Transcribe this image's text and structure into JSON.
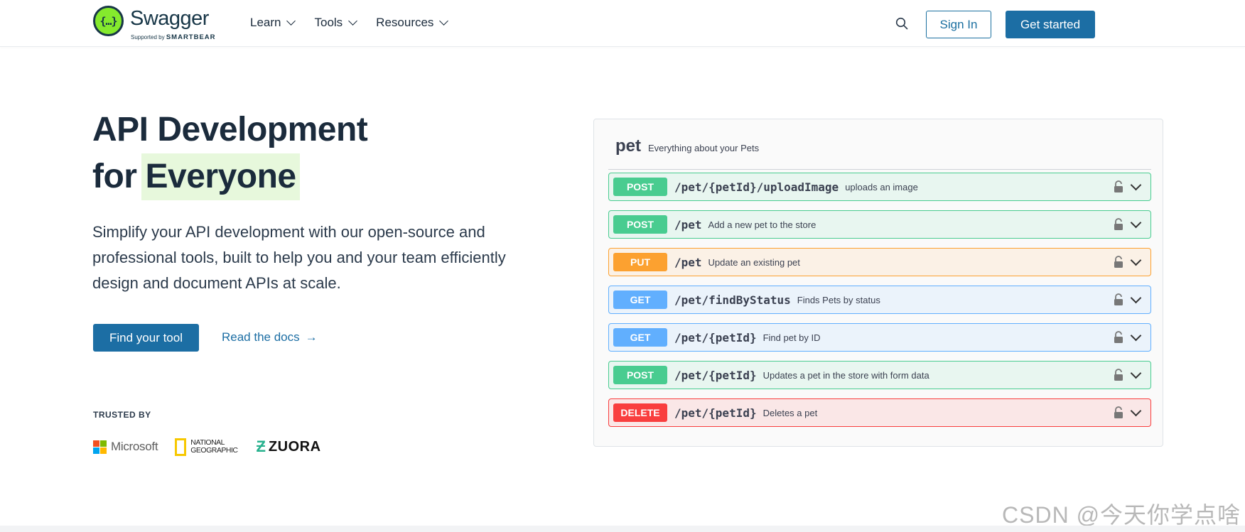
{
  "header": {
    "logo": {
      "word": "Swagger",
      "supported_by": "Supported by",
      "brand": "SMARTBEAR"
    },
    "nav": [
      {
        "label": "Learn"
      },
      {
        "label": "Tools"
      },
      {
        "label": "Resources"
      }
    ],
    "signin_label": "Sign In",
    "getstarted_label": "Get started"
  },
  "hero": {
    "title_line1": "API Development",
    "title_line2_a": "for",
    "title_line2_b": "Everyone",
    "description": "Simplify your API development with our open-source and professional tools, built to help you and your team efficiently design and document APIs at scale.",
    "primary_cta": "Find your tool",
    "secondary_cta": "Read the docs",
    "secondary_arrow": "→"
  },
  "trusted": {
    "label": "TRUSTED BY",
    "logos": [
      {
        "name": "Microsoft"
      },
      {
        "name_line1": "NATIONAL",
        "name_line2": "GEOGRAPHIC"
      },
      {
        "name": "ZUORA"
      }
    ]
  },
  "panel": {
    "tag": "pet",
    "tag_description": "Everything about your Pets",
    "operations": [
      {
        "method": "POST",
        "path": "/pet/{petId}/uploadImage",
        "summary": "uploads an image"
      },
      {
        "method": "POST",
        "path": "/pet",
        "summary": "Add a new pet to the store"
      },
      {
        "method": "PUT",
        "path": "/pet",
        "summary": "Update an existing pet"
      },
      {
        "method": "GET",
        "path": "/pet/findByStatus",
        "summary": "Finds Pets by status"
      },
      {
        "method": "GET",
        "path": "/pet/{petId}",
        "summary": "Find pet by ID"
      },
      {
        "method": "POST",
        "path": "/pet/{petId}",
        "summary": "Updates a pet in the store with form data"
      },
      {
        "method": "DELETE",
        "path": "/pet/{petId}",
        "summary": "Deletes a pet"
      }
    ]
  },
  "colors": {
    "brand_blue": "#1c6ea4",
    "swagger_green": "#85ea2d",
    "post": "#49cc90",
    "put": "#fca130",
    "get": "#61affe",
    "delete": "#f93e3e"
  },
  "watermark": "CSDN @今天你学点啥"
}
